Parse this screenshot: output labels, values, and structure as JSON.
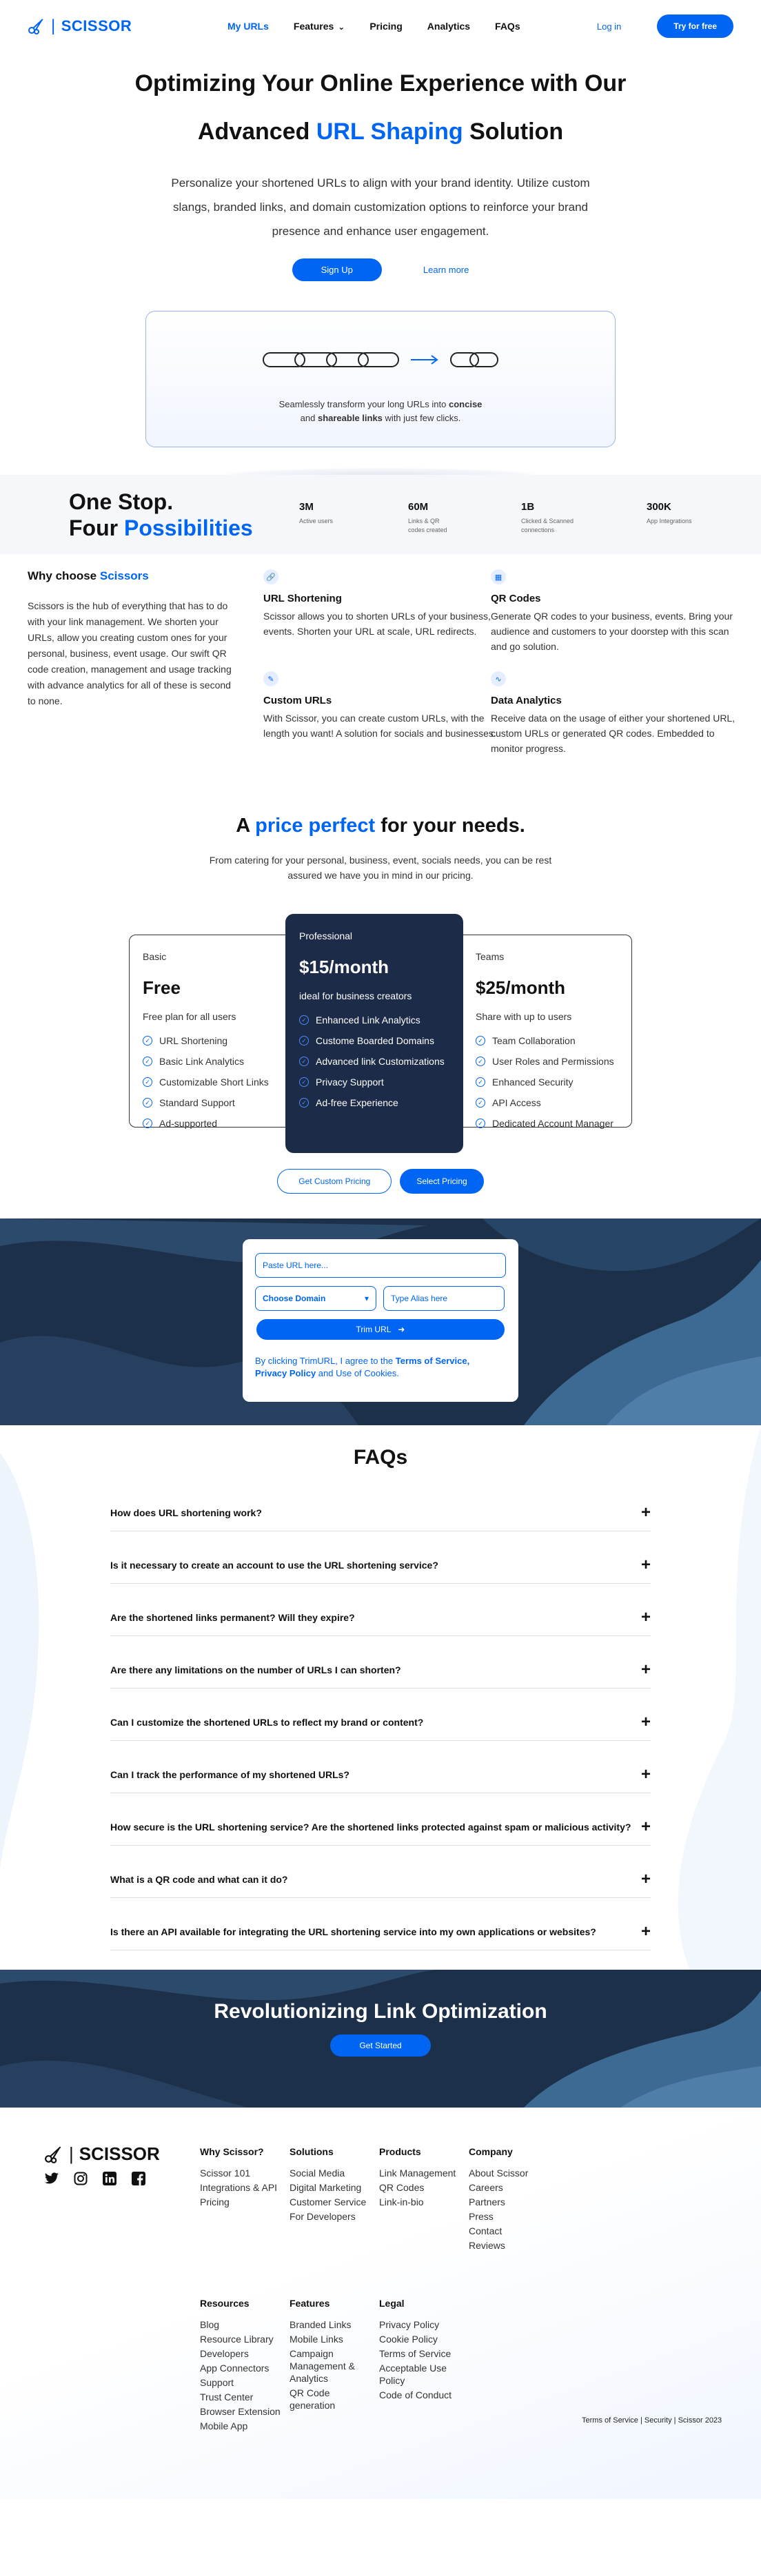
{
  "nav": {
    "brand": "SCISSOR",
    "links": [
      {
        "label": "My URLs",
        "active": true
      },
      {
        "label": "Features",
        "dropdown": true
      },
      {
        "label": "Pricing"
      },
      {
        "label": "Analytics"
      },
      {
        "label": "FAQs"
      }
    ],
    "login": "Log in",
    "cta": "Try for free"
  },
  "hero": {
    "title_line1": "Optimizing Your Online Experience with Our",
    "title_pre": "Advanced",
    "title_highlight": "URL Shaping",
    "title_post": "Solution",
    "subtitle": "Personalize your shortened URLs to align with your brand identity. Utilize custom slangs, branded links, and domain customization options to reinforce your brand presence and enhance user engagement.",
    "signup": "Sign Up",
    "learn_more": "Learn more",
    "illustration_caption_pre": "Seamlessly transform your long URLs into",
    "illustration_caption_b1": "concise",
    "illustration_caption_mid": "and",
    "illustration_caption_b2": "shareable links",
    "illustration_caption_post": "with just few clicks."
  },
  "stats": {
    "heading1": "One Stop.",
    "heading2_pre": "Four",
    "heading2_highlight": "Possibilities",
    "items": [
      {
        "value": "3M",
        "label": "Active users"
      },
      {
        "value": "60M",
        "label": "Links & QR codes created"
      },
      {
        "value": "1B",
        "label": "Clicked & Scanned connections"
      },
      {
        "value": "300K",
        "label": "App Integrations"
      }
    ]
  },
  "why": {
    "title_pre": "Why choose",
    "title_highlight": "Scissors",
    "body": "Scissors is the hub of everything that has to do with your link management. We shorten your URLs, allow you creating custom ones for your personal, business, event usage. Our swift QR code creation, management and usage tracking with advance analytics for all of these is second to none.",
    "features": [
      {
        "icon": "link-icon",
        "title": "URL Shortening",
        "text": "Scissor allows you to shorten URLs of your business, events. Shorten your URL at scale, URL redirects."
      },
      {
        "icon": "qr-code-icon",
        "title": "QR Codes",
        "text": "Generate QR codes to your business, events. Bring your audience and customers to your doorstep with this scan and go solution."
      },
      {
        "icon": "edit-icon",
        "title": "Custom URLs",
        "text": "With Scissor, you can create custom URLs, with the length you want! A solution for socials and businesses."
      },
      {
        "icon": "analytics-icon",
        "title": "Data Analytics",
        "text": "Receive data on the usage of either your shortened URL, custom URLs or generated QR codes. Embedded to monitor progress."
      }
    ]
  },
  "pricing": {
    "title_pre": "A",
    "title_highlight": "price perfect",
    "title_post": "for your needs.",
    "subtitle": "From catering for your personal, business, event, socials needs, you can be rest assured we have you in mind in our pricing.",
    "plans": [
      {
        "name": "Basic",
        "price": "Free",
        "desc": "Free plan for all users",
        "features": [
          "URL Shortening",
          "Basic Link Analytics",
          "Customizable Short Links",
          "Standard Support",
          "Ad-supported"
        ]
      },
      {
        "name": "Professional",
        "price": "$15/month",
        "desc": "ideal for business creators",
        "features": [
          "Enhanced Link Analytics",
          "Custome Boarded Domains",
          "Advanced link Customizations",
          "Privacy Support",
          "Ad-free Experience"
        ]
      },
      {
        "name": "Teams",
        "price": "$25/month",
        "desc": "Share with up to users",
        "features": [
          "Team Collaboration",
          "User Roles and Permissions",
          "Enhanced Security",
          "API Access",
          "Dedicated Account Manager"
        ]
      }
    ],
    "custom_btn": "Get Custom Pricing",
    "select_btn": "Select Pricing"
  },
  "trim": {
    "url_placeholder": "Paste URL here...",
    "domain_select": "Choose Domain",
    "alias_placeholder": "Type Alias here",
    "button": "Trim URL",
    "terms_pre": "By clicking TrimURL, I agree to the",
    "terms_link1": "Terms of Service,",
    "terms_link2": "Privacy Policy",
    "terms_post": "and Use of Cookies."
  },
  "faq": {
    "title": "FAQs",
    "items": [
      "How does URL shortening work?",
      "Is it necessary to create an account to use the URL shortening service?",
      "Are the shortened links permanent? Will they expire?",
      "Are there any limitations on the number of URLs I can shorten?",
      "Can I customize the shortened URLs to reflect my brand or content?",
      "Can I track the performance of my shortened URLs?",
      "How secure is the URL shortening service? Are the shortened links protected against spam or malicious activity?",
      "What is a QR code and what can it do?",
      "Is there an API available for integrating the URL shortening service into my own applications or websites?"
    ]
  },
  "cta": {
    "title": "Revolutionizing Link Optimization",
    "button": "Get Started"
  },
  "footer": {
    "brand": "SCISSOR",
    "socials": [
      "twitter-icon",
      "instagram-icon",
      "linkedin-icon",
      "facebook-icon"
    ],
    "columns": [
      {
        "title": "Why Scissor?",
        "links": [
          "Scissor 101",
          "Integrations & API",
          "Pricing"
        ]
      },
      {
        "title": "Solutions",
        "links": [
          "Social Media",
          "Digital Marketing",
          "Customer Service",
          "For Developers"
        ]
      },
      {
        "title": "Products",
        "links": [
          "Link Management",
          "QR Codes",
          "Link-in-bio"
        ]
      },
      {
        "title": "Company",
        "links": [
          "About Scissor",
          "Careers",
          "Partners",
          "Press",
          "Contact",
          "Reviews"
        ]
      },
      {
        "title": "Resources",
        "links": [
          "Blog",
          "Resource Library",
          "Developers",
          "App Connectors",
          "Support",
          "Trust Center",
          "Browser Extension",
          "Mobile App"
        ]
      },
      {
        "title": "Features",
        "links": [
          "Branded Links",
          "Mobile Links",
          "Campaign Management & Analytics",
          "QR Code generation"
        ]
      },
      {
        "title": "Legal",
        "links": [
          "Privacy Policy",
          "Cookie Policy",
          "Terms of Service",
          "Acceptable Use Policy",
          "Code of Conduct"
        ]
      }
    ],
    "copyright": "Terms of Service | Security | Scissor 2023"
  },
  "colors": {
    "primary": "#0065F2",
    "dark": "#1B2B48"
  }
}
